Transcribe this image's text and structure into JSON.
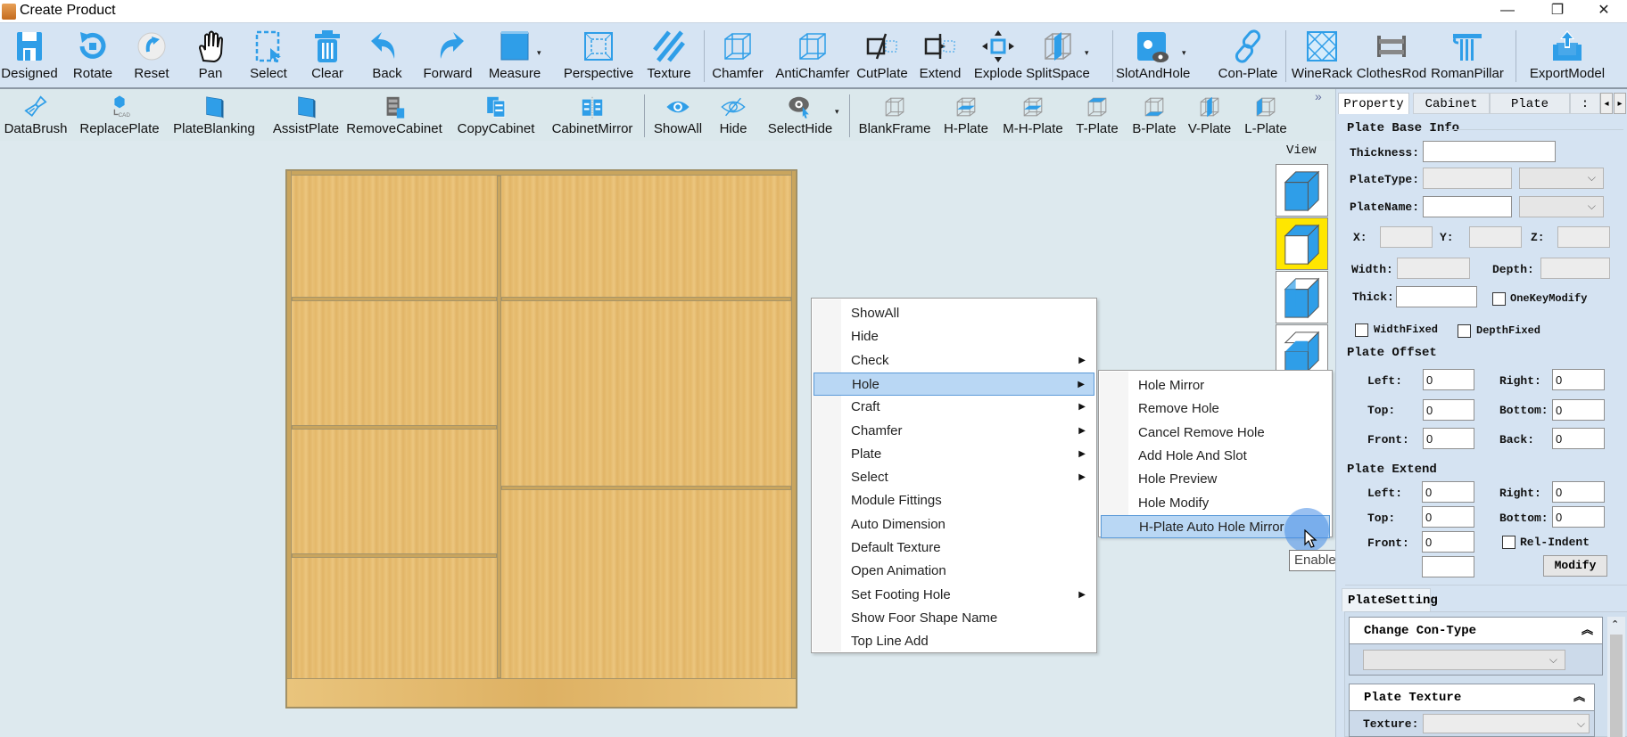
{
  "window": {
    "title": "Create Product",
    "controls": {
      "minimize": "—",
      "maximize": "❐",
      "close": "✕"
    }
  },
  "toolbar_main": [
    {
      "label": "Designed",
      "icon": "save-icon"
    },
    {
      "label": "Rotate",
      "icon": "rotate-icon"
    },
    {
      "label": "Reset",
      "icon": "reset-icon"
    },
    {
      "label": "Pan",
      "icon": "hand-icon"
    },
    {
      "label": "Select",
      "icon": "select-icon"
    },
    {
      "label": "Clear",
      "icon": "trash-icon"
    },
    {
      "label": "Back",
      "icon": "undo-icon"
    },
    {
      "label": "Forward",
      "icon": "redo-icon"
    },
    {
      "label": "Measure",
      "icon": "measure-icon",
      "dropdown": true
    },
    {
      "label": "Perspective",
      "icon": "perspective-icon"
    },
    {
      "label": "Texture",
      "icon": "texture-icon"
    },
    {
      "label": "Chamfer",
      "icon": "chamfer-icon"
    },
    {
      "label": "AntiChamfer",
      "icon": "antichamfer-icon"
    },
    {
      "label": "CutPlate",
      "icon": "cutplate-icon"
    },
    {
      "label": "Extend",
      "icon": "extend-icon"
    },
    {
      "label": "Explode",
      "icon": "explode-icon"
    },
    {
      "label": "SplitSpace",
      "icon": "splitspace-icon",
      "dropdown": true
    },
    {
      "label": "SlotAndHole",
      "icon": "slot-hole-icon",
      "dropdown": true
    },
    {
      "label": "Con-Plate",
      "icon": "link-icon"
    },
    {
      "label": "WineRack",
      "icon": "winerack-icon"
    },
    {
      "label": "ClothesRod",
      "icon": "clothesrod-icon"
    },
    {
      "label": "RomanPillar",
      "icon": "pillar-icon"
    },
    {
      "label": "ExportModel",
      "icon": "export-icon"
    }
  ],
  "toolbar_secondary": [
    {
      "label": "DataBrush",
      "icon": "brush-icon"
    },
    {
      "label": "ReplacePlate",
      "icon": "replace-plate-icon"
    },
    {
      "label": "PlateBlanking",
      "icon": "plate-blanking-icon"
    },
    {
      "label": "AssistPlate",
      "icon": "assist-plate-icon"
    },
    {
      "label": "RemoveCabinet",
      "icon": "remove-cabinet-icon"
    },
    {
      "label": "CopyCabinet",
      "icon": "copy-cabinet-icon"
    },
    {
      "label": "CabinetMirror",
      "icon": "cabinet-mirror-icon"
    },
    {
      "label": "ShowAll",
      "icon": "eye-icon"
    },
    {
      "label": "Hide",
      "icon": "eye-off-icon"
    },
    {
      "label": "SelectHide",
      "icon": "select-hide-icon",
      "dropdown": true
    },
    {
      "label": "BlankFrame",
      "icon": "blank-frame-icon"
    },
    {
      "label": "H-Plate",
      "icon": "h-plate-icon"
    },
    {
      "label": "M-H-Plate",
      "icon": "m-h-plate-icon"
    },
    {
      "label": "T-Plate",
      "icon": "t-plate-icon"
    },
    {
      "label": "B-Plate",
      "icon": "b-plate-icon"
    },
    {
      "label": "V-Plate",
      "icon": "v-plate-icon"
    },
    {
      "label": "L-Plate",
      "icon": "l-plate-icon"
    }
  ],
  "overflow_chevron": "»",
  "view": {
    "label": "View",
    "cubes": [
      {
        "name": "view-iso",
        "active": false
      },
      {
        "name": "view-front",
        "active": true
      },
      {
        "name": "view-open-top",
        "active": false
      },
      {
        "name": "view-open-corner",
        "active": false
      }
    ]
  },
  "context_menu": {
    "items": [
      {
        "label": "ShowAll",
        "submenu": false
      },
      {
        "label": "Hide",
        "submenu": false
      },
      {
        "label": "Check",
        "submenu": true
      },
      {
        "label": "Hole",
        "submenu": true,
        "highlighted": true
      },
      {
        "label": "Craft",
        "submenu": true
      },
      {
        "label": "Chamfer",
        "submenu": true
      },
      {
        "label": "Plate",
        "submenu": true
      },
      {
        "label": "Select",
        "submenu": true
      },
      {
        "label": "Module Fittings",
        "submenu": false
      },
      {
        "label": "Auto Dimension",
        "submenu": false
      },
      {
        "label": "Default Texture",
        "submenu": false
      },
      {
        "label": "Open Animation",
        "submenu": false
      },
      {
        "label": "Set Footing Hole",
        "submenu": true
      },
      {
        "label": "Show Foor Shape Name",
        "submenu": false
      },
      {
        "label": "Top Line Add",
        "submenu": false
      }
    ],
    "submenu_arrow": "▶"
  },
  "hole_submenu": {
    "items": [
      {
        "label": "Hole Mirror"
      },
      {
        "label": "Remove Hole"
      },
      {
        "label": "Cancel Remove Hole"
      },
      {
        "label": "Add Hole And Slot"
      },
      {
        "label": "Hole Preview"
      },
      {
        "label": "Hole Modify"
      },
      {
        "label": "H-Plate Auto Hole Mirror",
        "highlighted": true
      }
    ]
  },
  "tooltip": "Enable the auto hole mirror of plate",
  "right_panel": {
    "tabs": [
      {
        "label": "Property",
        "active": true
      },
      {
        "label": "Cabinet",
        "active": false
      },
      {
        "label": "Plate",
        "active": false
      },
      {
        "label": ":",
        "active": false
      }
    ],
    "tab_scroll": {
      "left": "◂",
      "right": "▸"
    },
    "plate_base_info": {
      "title": "Plate Base Info",
      "thickness_label": "Thickness:",
      "thickness_value": "",
      "platetype_label": "PlateType:",
      "platetype_value": "",
      "platename_label": "PlateName:",
      "platename_value": "",
      "x_label": "X:",
      "x_value": "",
      "y_label": "Y:",
      "y_value": "",
      "z_label": "Z:",
      "z_value": "",
      "width_label": "Width:",
      "width_value": "",
      "depth_label": "Depth:",
      "depth_value": "",
      "thick_label": "Thick:",
      "thick_value": "",
      "onekey_label": "OneKeyModify",
      "onekey_checked": false,
      "widthfixed_label": "WidthFixed",
      "widthfixed_checked": false,
      "depthfixed_label": "DepthFixed",
      "depthfixed_checked": false
    },
    "plate_offset": {
      "title": "Plate Offset",
      "left_label": "Left:",
      "left_value": "0",
      "right_label": "Right:",
      "right_value": "0",
      "top_label": "Top:",
      "top_value": "0",
      "bottom_label": "Bottom:",
      "bottom_value": "0",
      "front_label": "Front:",
      "front_value": "0",
      "back_label": "Back:",
      "back_value": "0"
    },
    "plate_extend": {
      "title": "Plate Extend",
      "left_label": "Left:",
      "left_value": "0",
      "right_label": "Right:",
      "right_value": "0",
      "top_label": "Top:",
      "top_value": "0",
      "bottom_label": "Bottom:",
      "bottom_value": "0",
      "front_label": "Front:",
      "front_value": "0",
      "relindent_label": "Rel-Indent",
      "relindent_checked": false,
      "modify_label": "Modify"
    },
    "plate_setting": {
      "tab_label": "PlateSetting",
      "change_con_type": {
        "title": "Change Con-Type",
        "value": ""
      },
      "plate_texture": {
        "title": "Plate Texture",
        "texture_label": "Texture:",
        "texture_value": ""
      },
      "collapse_glyph": "⌃"
    }
  },
  "colors": {
    "accent_blue": "#2f9ee8",
    "toolbar_bg": "#d6e4f3",
    "menu_highlight": "#b9d7f4",
    "view_active": "#ffe600",
    "wood": "#e6bb6e"
  }
}
